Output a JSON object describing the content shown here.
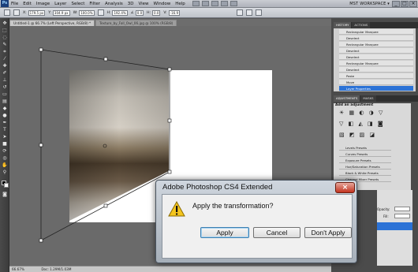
{
  "menubar": {
    "logo": "Ps",
    "items": [
      "File",
      "Edit",
      "Image",
      "Layer",
      "Select",
      "Filter",
      "Analysis",
      "3D",
      "View",
      "Window",
      "Help"
    ],
    "workspace": "MST WORKSPACE ▾",
    "window_buttons": [
      "_",
      "□",
      "×"
    ]
  },
  "options": {
    "x_label": "X:",
    "x_value": "179.5 px",
    "y_label": "Y:",
    "y_value": "304.9 px",
    "w_label": "W:",
    "w_value": "100.0%",
    "h_label": "H:",
    "h_value": "192.4%",
    "rot_value": "0.0",
    "h_skew_label": "H:",
    "h_skew_value": "0.0",
    "v_skew_label": "V:",
    "v_skew_value": "-16.9"
  },
  "tabs": [
    "Untitled-1 @ 66.7% (Left Perspective, RGB/8) *",
    "Texture_by_Fall_Owl_06.jpg @ 100% (RGB/8)"
  ],
  "status": {
    "zoom": "66.67%",
    "doc": "Doc: 1.29M/1.03M"
  },
  "history_panel": {
    "tabs": [
      "HISTORY",
      "ACTIONS"
    ],
    "items": [
      "Rectangular Marquee",
      "Deselect",
      "Rectangular Marquee",
      "Deselect",
      "Deselect",
      "Rectangular Marquee",
      "Deselect",
      "Paste",
      "Move",
      "Layer Properties"
    ],
    "selected_index": 9
  },
  "adjustments_panel": {
    "tabs": [
      "ADJUSTMENTS",
      "MASKS"
    ],
    "heading": "Add an adjustment",
    "presets": [
      "Levels Presets",
      "Curves Presets",
      "Exposure Presets",
      "Hue/Saturation Presets",
      "Black & White Presets",
      "Channel Mixer Presets"
    ]
  },
  "layers_panel": {
    "opacity_label": "Opacity:",
    "fill_label": "Fill:"
  },
  "dialog": {
    "title": "Adobe Photoshop CS4 Extended",
    "close": "×",
    "message": "Apply the transformation?",
    "buttons": {
      "apply": "Apply",
      "cancel": "Cancel",
      "dont_apply": "Don't Apply"
    },
    "icon": "warning-icon"
  },
  "colors": {
    "accent": "#2b72d6",
    "dialog_close": "#c2331f",
    "workspace_bg": "#6a6a6a"
  }
}
